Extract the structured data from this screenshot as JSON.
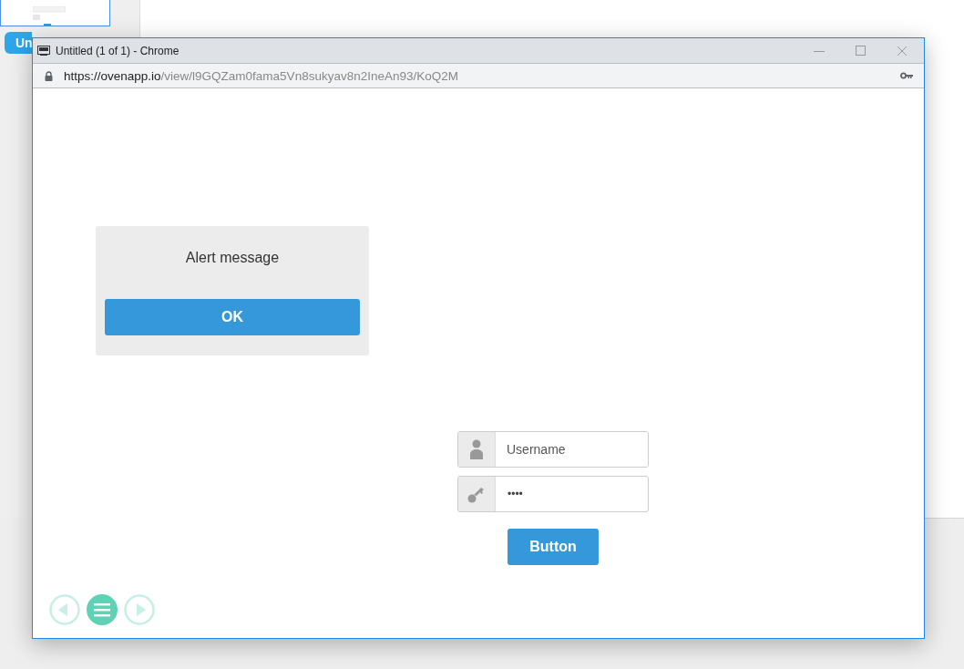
{
  "background_app": {
    "page_badge": "Un"
  },
  "window": {
    "title": "Untitled (1 of 1) - Chrome",
    "url": {
      "host": "https://ovenapp.io",
      "path": "/view/l9GQZam0fama5Vn8sukyav8n2IneAn93/KoQ2M"
    }
  },
  "alert": {
    "message": "Alert message",
    "button": "OK"
  },
  "login": {
    "username": {
      "placeholder": "Username"
    },
    "password": {
      "value": "••••"
    },
    "button": "Button"
  },
  "nav": [
    {
      "kind": "prev",
      "disabled": true
    },
    {
      "kind": "menu",
      "disabled": false
    },
    {
      "kind": "next",
      "disabled": true
    }
  ]
}
